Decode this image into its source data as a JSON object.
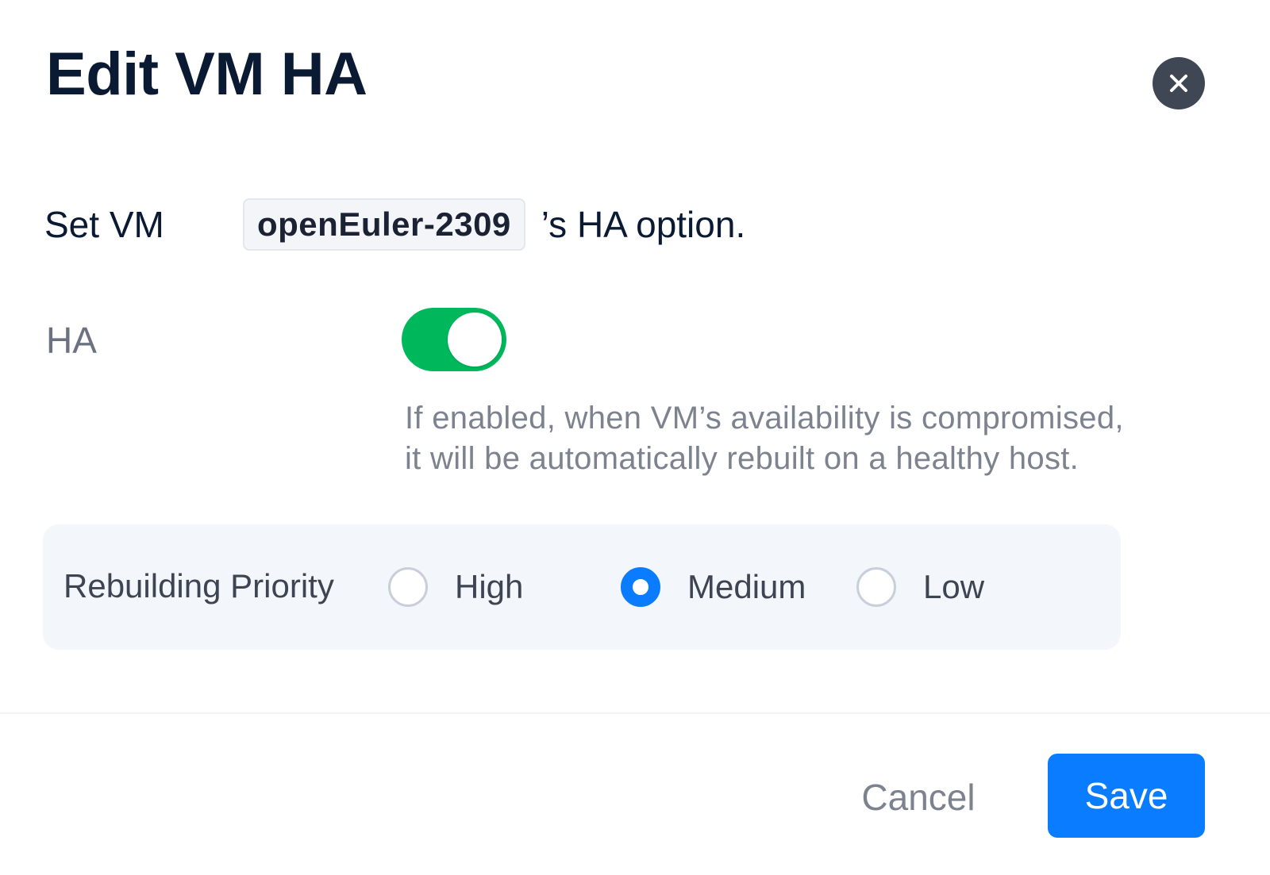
{
  "dialog": {
    "title": "Edit VM HA",
    "close_icon": "close-icon"
  },
  "set_vm": {
    "prefix": "Set VM",
    "vm_name": "openEuler-2309",
    "suffix": "’s HA option."
  },
  "ha": {
    "label": "HA",
    "enabled": true,
    "help_line1": "If enabled, when VM’s availability is compromised,",
    "help_line2": "it will be automatically rebuilt on a healthy host."
  },
  "priority": {
    "label": "Rebuilding Priority",
    "options": [
      {
        "label": "High",
        "selected": false
      },
      {
        "label": "Medium",
        "selected": true
      },
      {
        "label": "Low",
        "selected": false
      }
    ]
  },
  "footer": {
    "cancel_label": "Cancel",
    "save_label": "Save"
  },
  "colors": {
    "accent": "#0a7cff",
    "toggle_on": "#00b85c",
    "title": "#0b1a33"
  }
}
